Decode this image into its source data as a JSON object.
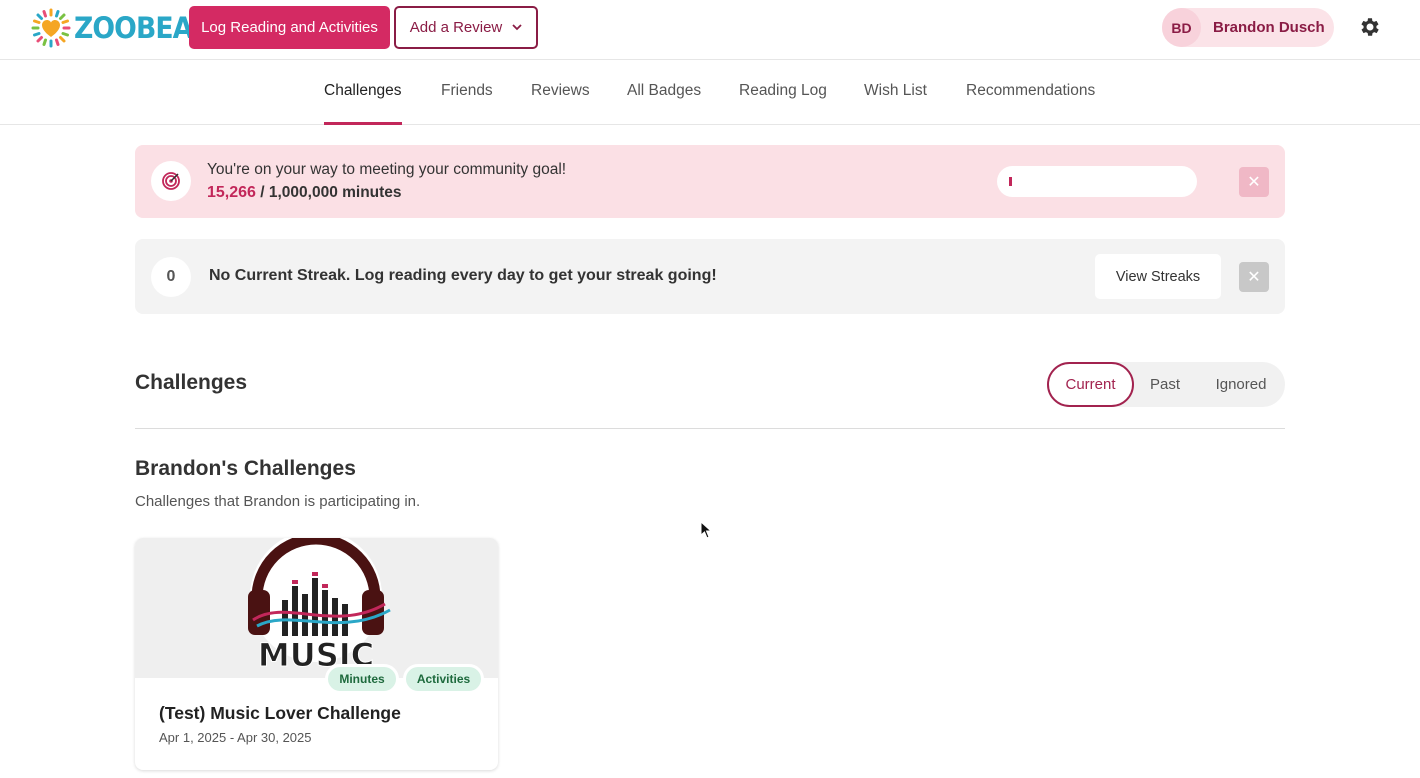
{
  "header": {
    "logo_text": "ZOOBEAN",
    "log_button": "Log Reading and Activities",
    "review_button": "Add a Review",
    "user_initials": "BD",
    "user_name": "Brandon Dusch"
  },
  "nav": {
    "tabs": [
      {
        "label": "Challenges",
        "active": true
      },
      {
        "label": "Friends"
      },
      {
        "label": "Reviews"
      },
      {
        "label": "All Badges"
      },
      {
        "label": "Reading Log"
      },
      {
        "label": "Wish List"
      },
      {
        "label": "Recommendations"
      }
    ]
  },
  "goal_banner": {
    "message": "You're on your way to meeting your community goal!",
    "current": "15,266",
    "total": " / 1,000,000 minutes",
    "progress_fraction": 0.015
  },
  "streak_banner": {
    "count": "0",
    "message": "No Current Streak. Log reading every day to get your streak going!",
    "button": "View Streaks"
  },
  "challenges": {
    "title": "Challenges",
    "filters": [
      "Current",
      "Past",
      "Ignored"
    ],
    "active_filter": "Current",
    "section_title": "Brandon's Challenges",
    "section_desc": "Challenges that Brandon is participating in.",
    "cards": [
      {
        "title": "(Test) Music Lover Challenge",
        "dates": "Apr 1, 2025 - Apr 30, 2025",
        "tags": [
          "Minutes",
          "Activities"
        ],
        "image_text": "MUSIC"
      }
    ]
  },
  "colors": {
    "primary": "#d42a63",
    "dark_primary": "#8a1c45",
    "goal_bg": "#fbe0e5",
    "streak_bg": "#f3f3f3",
    "tag_bg": "#d9f2e6"
  }
}
